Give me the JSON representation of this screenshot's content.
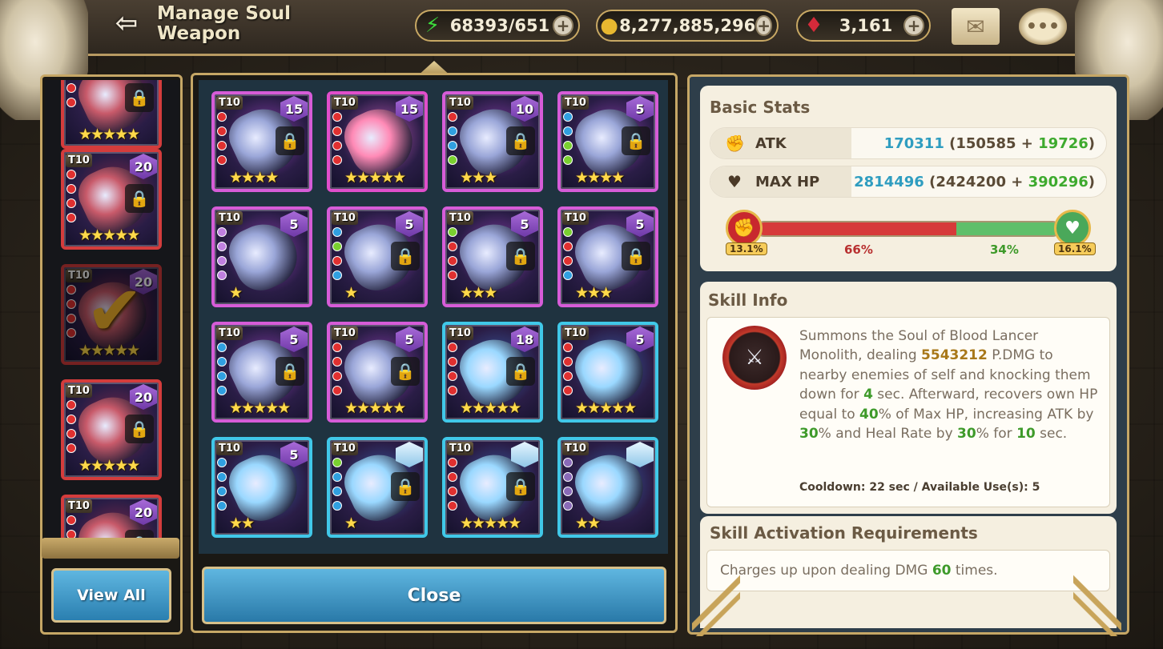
{
  "header": {
    "back_icon": "back-arrow-icon",
    "title": "Manage Soul Weapon",
    "resources": [
      {
        "name": "stamina",
        "icon": "lightning-icon",
        "value": "68393/651",
        "color": "#3cdc3c"
      },
      {
        "name": "gold",
        "icon": "gold-coin-icon",
        "value": "8,277,885,296",
        "color": "#e8b830"
      },
      {
        "name": "rubies",
        "icon": "ruby-icon",
        "value": "3,161",
        "color": "#d42a3a"
      }
    ],
    "plus_glyph": "+",
    "mail_icon": "mail-icon",
    "chat_icon": "chat-bubble-icon"
  },
  "left_list": {
    "cards": [
      {
        "tier": "T10",
        "level": "",
        "stars": "★★★★★",
        "locked": true,
        "frame": "red",
        "gems": [
          "#e03030",
          "#e03030",
          "#e03030"
        ]
      },
      {
        "tier": "T10",
        "level": "20",
        "stars": "★★★★★",
        "locked": true,
        "frame": "red",
        "gems": [
          "#e03030",
          "#e03030",
          "#e03030",
          "#e03030"
        ]
      },
      {
        "tier": "T10",
        "level": "20",
        "stars": "★★★★★",
        "locked": false,
        "frame": "red",
        "selected": true,
        "gems": [
          "#e03030",
          "#e03030",
          "#e03030",
          "#e03030"
        ]
      },
      {
        "tier": "T10",
        "level": "20",
        "stars": "★★★★★",
        "locked": true,
        "frame": "red",
        "gems": [
          "#e03030",
          "#e03030",
          "#e03030",
          "#e03030"
        ]
      },
      {
        "tier": "T10",
        "level": "20",
        "stars": "★★★★★",
        "locked": true,
        "frame": "red",
        "gems": [
          "#e03030",
          "#e03030",
          "#e03030",
          "#e03030"
        ]
      }
    ],
    "check_glyph": "✔",
    "view_all_label": "View All"
  },
  "grid": {
    "cards": [
      {
        "tier": "T10",
        "level": "15",
        "stars": "★★★★",
        "locked": true,
        "frame": "purple",
        "gems": [
          "#e03030",
          "#e03030",
          "#e03030",
          "#e03030"
        ]
      },
      {
        "tier": "T10",
        "level": "15",
        "stars": "★★★★★",
        "locked": false,
        "frame": "pink",
        "gems": [
          "#e03030",
          "#e03030",
          "#e03030",
          "#e03030"
        ]
      },
      {
        "tier": "T10",
        "level": "10",
        "stars": "★★★",
        "locked": true,
        "frame": "purple",
        "gems": [
          "#e03030",
          "#30a0e0",
          "#30a0e0",
          "#7ad030"
        ]
      },
      {
        "tier": "T10",
        "level": "5",
        "stars": "★★★★",
        "locked": true,
        "frame": "purple",
        "gems": [
          "#30a0e0",
          "#30a0e0",
          "#7ad030",
          "#7ad030"
        ]
      },
      {
        "tier": "T10",
        "level": "5",
        "stars": "★",
        "locked": false,
        "frame": "purple",
        "gems": [
          "#c080e0",
          "#c080e0",
          "#c080e0",
          "#c080e0"
        ]
      },
      {
        "tier": "T10",
        "level": "5",
        "stars": "★",
        "locked": true,
        "frame": "purple",
        "gems": [
          "#30a0e0",
          "#7ad030",
          "#e03030",
          "#30a0e0"
        ]
      },
      {
        "tier": "T10",
        "level": "5",
        "stars": "★★★",
        "locked": true,
        "frame": "purple",
        "gems": [
          "#7ad030",
          "#e03030",
          "#e03030",
          "#e03030"
        ]
      },
      {
        "tier": "T10",
        "level": "5",
        "stars": "★★★",
        "locked": true,
        "frame": "purple",
        "gems": [
          "#7ad030",
          "#e03030",
          "#e03030",
          "#30a0e0"
        ]
      },
      {
        "tier": "T10",
        "level": "5",
        "stars": "★★★★★",
        "locked": true,
        "frame": "purple",
        "gems": [
          "#30a0e0",
          "#30a0e0",
          "#30a0e0",
          "#30a0e0"
        ]
      },
      {
        "tier": "T10",
        "level": "5",
        "stars": "★★★★★",
        "locked": true,
        "frame": "purple",
        "gems": [
          "#e03030",
          "#e03030",
          "#e03030",
          "#e03030"
        ]
      },
      {
        "tier": "T10",
        "level": "18",
        "stars": "★★★★★",
        "locked": true,
        "frame": "blue",
        "gems": [
          "#e03030",
          "#e03030",
          "#e03030",
          "#e03030"
        ]
      },
      {
        "tier": "T10",
        "level": "5",
        "stars": "★★★★★",
        "locked": false,
        "frame": "blue",
        "gems": [
          "#e03030",
          "#e03030",
          "#e03030",
          "#e03030"
        ]
      },
      {
        "tier": "T10",
        "level": "5",
        "stars": "★★",
        "locked": false,
        "frame": "blue",
        "gems": [
          "#30a0e0",
          "#30a0e0",
          "#30a0e0",
          "#30a0e0"
        ]
      },
      {
        "tier": "T10",
        "level": "",
        "stars": "★",
        "locked": true,
        "frame": "blue",
        "crystal": true,
        "gems": [
          "#7ad030",
          "#30a0e0",
          "#30a0e0",
          "#30a0e0"
        ]
      },
      {
        "tier": "T10",
        "level": "",
        "stars": "★★★★★",
        "locked": true,
        "frame": "blue",
        "crystal": true,
        "gems": [
          "#e03030",
          "#e03030",
          "#e03030",
          "#e03030"
        ]
      },
      {
        "tier": "T10",
        "level": "",
        "stars": "★★",
        "locked": false,
        "frame": "blue",
        "crystal": true,
        "gems": [
          "#8a6ab8",
          "#8a6ab8",
          "#8a6ab8",
          "#8a6ab8"
        ]
      }
    ],
    "lock_glyph": "🔒",
    "close_label": "Close"
  },
  "basic_stats": {
    "title": "Basic Stats",
    "rows": [
      {
        "label": "ATK",
        "icon": "fist-icon",
        "total": "170311",
        "base": "150585",
        "bonus": "19726"
      },
      {
        "label": "MAX HP",
        "icon": "heart-icon",
        "total": "2814496",
        "base": "2424200",
        "bonus": "390296"
      }
    ],
    "ratio": {
      "atk_left": "13.1%",
      "atk_pct": "66%",
      "hp_pct": "34%",
      "hp_right": "16.1%",
      "atk_fraction": 0.66,
      "atk_color": "#d63a3a",
      "hp_color": "#5fbf6a"
    }
  },
  "skill_info": {
    "title": "Skill Info",
    "icon": "blood-lancer-weapon-icon",
    "desc_parts": [
      {
        "t": "Summons the Soul of Blood Lancer Monolith, dealing ",
        "c": ""
      },
      {
        "t": "5543212",
        "c": "hl-gold"
      },
      {
        "t": " P.DMG to nearby enemies of self and knocking them down for ",
        "c": ""
      },
      {
        "t": "4",
        "c": "hl-green"
      },
      {
        "t": " sec. Afterward, recovers own HP equal to ",
        "c": ""
      },
      {
        "t": "40",
        "c": "hl-green"
      },
      {
        "t": "% of Max HP, increasing ATK by ",
        "c": ""
      },
      {
        "t": "30",
        "c": "hl-green"
      },
      {
        "t": "% and Heal Rate by ",
        "c": ""
      },
      {
        "t": "30",
        "c": "hl-green"
      },
      {
        "t": "% for ",
        "c": ""
      },
      {
        "t": "10",
        "c": "hl-green"
      },
      {
        "t": " sec.",
        "c": ""
      }
    ],
    "cooldown": "Cooldown: 22 sec / Available Use(s): 5"
  },
  "requirements": {
    "title": "Skill Activation Requirements",
    "text_before": "Charges up upon dealing DMG ",
    "value": "60",
    "text_after": " times."
  }
}
